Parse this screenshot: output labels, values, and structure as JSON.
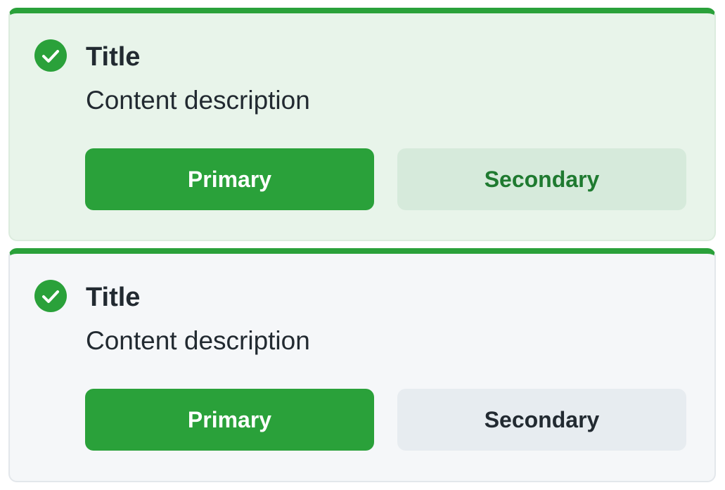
{
  "colors": {
    "accent": "#2aa13a",
    "success_bg": "#e8f4ea",
    "neutral_bg": "#f5f7f9",
    "text": "#222a31",
    "secondary_success_bg": "#d6eadb",
    "secondary_success_text": "#1f7a30",
    "secondary_neutral_bg": "#e7ecf0"
  },
  "cards": [
    {
      "icon": "check-circle-icon",
      "title": "Title",
      "description": "Content description",
      "primary_label": "Primary",
      "secondary_label": "Secondary"
    },
    {
      "icon": "check-circle-icon",
      "title": "Title",
      "description": "Content description",
      "primary_label": "Primary",
      "secondary_label": "Secondary"
    }
  ]
}
